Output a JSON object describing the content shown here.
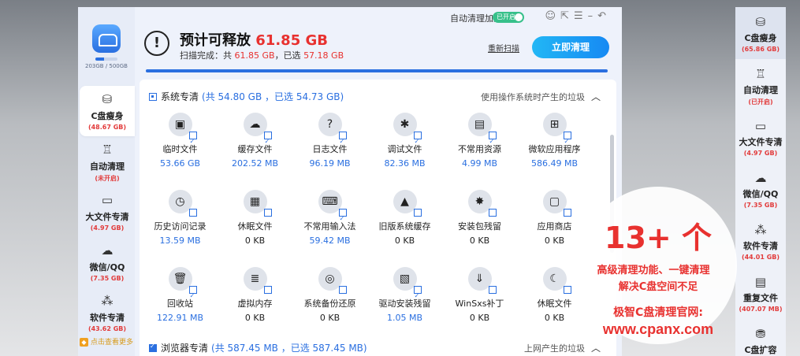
{
  "sidebar": {
    "disk_usage": "203GB / 500GB",
    "disk_fill_percent": 40.6,
    "items": [
      {
        "icon": "disk-slim-icon",
        "glyph": "⛁",
        "label": "C盘瘦身",
        "sub": "(48.67 GB)",
        "active": true
      },
      {
        "icon": "auto-clean-icon",
        "glyph": "♖",
        "label": "自动清理",
        "sub": "(未开启)"
      },
      {
        "icon": "folder-icon",
        "glyph": "▭",
        "label": "大文件专清",
        "sub": "(4.97 GB)"
      },
      {
        "icon": "wechat-icon",
        "glyph": "☁",
        "label": "微信/QQ",
        "sub": "(7.35 GB)"
      },
      {
        "icon": "apps-icon",
        "glyph": "⁂",
        "label": "软件专清",
        "sub": "(43.62 GB)"
      }
    ],
    "more_label": "点击查看更多"
  },
  "topbar": {
    "auto_clean_label": "自动清理加速",
    "toggle_label": "已开启",
    "icons": [
      "skin-icon",
      "share-icon",
      "menu-icon",
      "minimize-icon",
      "back-icon"
    ]
  },
  "header": {
    "title_prefix": "预计可释放 ",
    "title_value": "61.85 GB",
    "scan_prefix": "扫描完成：共 ",
    "scan_total": "61.85 GB",
    "scan_mid": "，已选 ",
    "scan_selected": "57.18 GB",
    "rescan_label": "重新扫描",
    "clean_button": "立即清理",
    "progress_percent": 100
  },
  "section1": {
    "title": "系统专清",
    "meta": "(共 54.80 GB ，已选 54.73 GB)",
    "right_text": "使用操作系统时产生的垃圾",
    "items": [
      {
        "name": "临时文件",
        "size": "53.66 GB",
        "icon": "temp-file-icon",
        "glyph": "▣",
        "checked": true
      },
      {
        "name": "缓存文件",
        "size": "202.52 MB",
        "icon": "cache-cloud-icon",
        "glyph": "☁",
        "checked": true
      },
      {
        "name": "日志文件",
        "size": "96.19 MB",
        "icon": "log-file-icon",
        "glyph": "?",
        "checked": true
      },
      {
        "name": "调试文件",
        "size": "82.36 MB",
        "icon": "debug-bug-icon",
        "glyph": "✱",
        "checked": true
      },
      {
        "name": "不常用资源",
        "size": "4.99 MB",
        "icon": "resource-icon",
        "glyph": "▤",
        "checked": true
      },
      {
        "name": "微软应用程序",
        "size": "586.49 MB",
        "icon": "windows-icon",
        "glyph": "⊞",
        "checked": true
      },
      {
        "name": "历史访问记录",
        "size": "13.59 MB",
        "icon": "history-icon",
        "glyph": "◷",
        "checked": false
      },
      {
        "name": "休眠文件",
        "size": "0 KB",
        "icon": "hibernate-icon",
        "glyph": "▦",
        "checked": false
      },
      {
        "name": "不常用输入法",
        "size": "59.42 MB",
        "icon": "keyboard-icon",
        "glyph": "⌨",
        "checked": true
      },
      {
        "name": "旧版系统缓存",
        "size": "0 KB",
        "icon": "old-system-icon",
        "glyph": "▲",
        "checked": false
      },
      {
        "name": "安装包残留",
        "size": "0 KB",
        "icon": "package-icon",
        "glyph": "✸",
        "checked": false
      },
      {
        "name": "应用商店",
        "size": "0 KB",
        "icon": "store-icon",
        "glyph": "▢",
        "checked": false
      },
      {
        "name": "回收站",
        "size": "122.91 MB",
        "icon": "recycle-bin-icon",
        "glyph": "🗑",
        "checked": true
      },
      {
        "name": "虚拟内存",
        "size": "0 KB",
        "icon": "virtual-memory-icon",
        "glyph": "≣",
        "checked": false
      },
      {
        "name": "系统备份还原",
        "size": "0 KB",
        "icon": "backup-icon",
        "glyph": "◎",
        "checked": false
      },
      {
        "name": "驱动安装残留",
        "size": "1.05 MB",
        "icon": "driver-icon",
        "glyph": "▧",
        "checked": true
      },
      {
        "name": "WinSxs补丁",
        "size": "0 KB",
        "icon": "winsxs-icon",
        "glyph": "⇓",
        "checked": false
      },
      {
        "name": "休眠文件",
        "size": "0 KB",
        "icon": "sleep-moon-icon",
        "glyph": "☾",
        "checked": false
      }
    ]
  },
  "section2": {
    "title": "浏览器专清",
    "meta": "(共 587.45 MB ，已选 587.45 MB)",
    "right_text": "上网产生的垃圾"
  },
  "right_panel": {
    "items": [
      {
        "icon": "disk-slim-icon",
        "glyph": "⛁",
        "label": "C盘瘦身",
        "sub": "(65.86 GB)",
        "active": true
      },
      {
        "icon": "auto-clean-icon",
        "glyph": "♖",
        "label": "自动清理",
        "sub": "(已开启)"
      },
      {
        "icon": "folder-icon",
        "glyph": "▭",
        "label": "大文件专清",
        "sub": "(4.97 GB)"
      },
      {
        "icon": "wechat-icon",
        "glyph": "☁",
        "label": "微信/QQ",
        "sub": "(7.35 GB)"
      },
      {
        "icon": "apps-icon",
        "glyph": "⁂",
        "label": "软件专清",
        "sub": "(44.01 GB)"
      },
      {
        "icon": "duplicate-icon",
        "glyph": "▤",
        "label": "重复文件",
        "sub": "(407.07 MB)"
      },
      {
        "icon": "expand-disk-icon",
        "glyph": "⛃",
        "label": "C盘扩容",
        "sub": ""
      }
    ]
  },
  "promo": {
    "big": "13+ 个",
    "line1": "高级清理功能、一键清理",
    "line2": "解决C盘空间不足",
    "line3": "极智C盘清理官网:",
    "line4": "www.cpanx.com"
  },
  "colors": {
    "accent": "#2a6fe0",
    "danger": "#e8312f",
    "toggle_on": "#37c08a"
  }
}
